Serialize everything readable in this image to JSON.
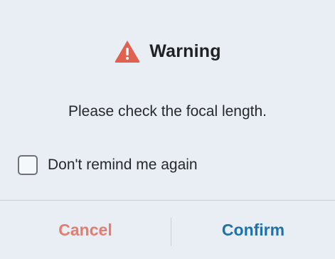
{
  "dialog": {
    "title": "Warning",
    "icon": "warning-triangle-icon",
    "message": "Please check the focal length.",
    "remind_checkbox": {
      "label": "Don't remind me again",
      "checked": false
    },
    "buttons": {
      "cancel_label": "Cancel",
      "confirm_label": "Confirm"
    }
  },
  "colors": {
    "background": "#e8eef3",
    "warning_icon": "#e0614f",
    "cancel_text": "#e47c6f",
    "confirm_text": "#1f72a8",
    "divider": "#c9d1d8"
  }
}
